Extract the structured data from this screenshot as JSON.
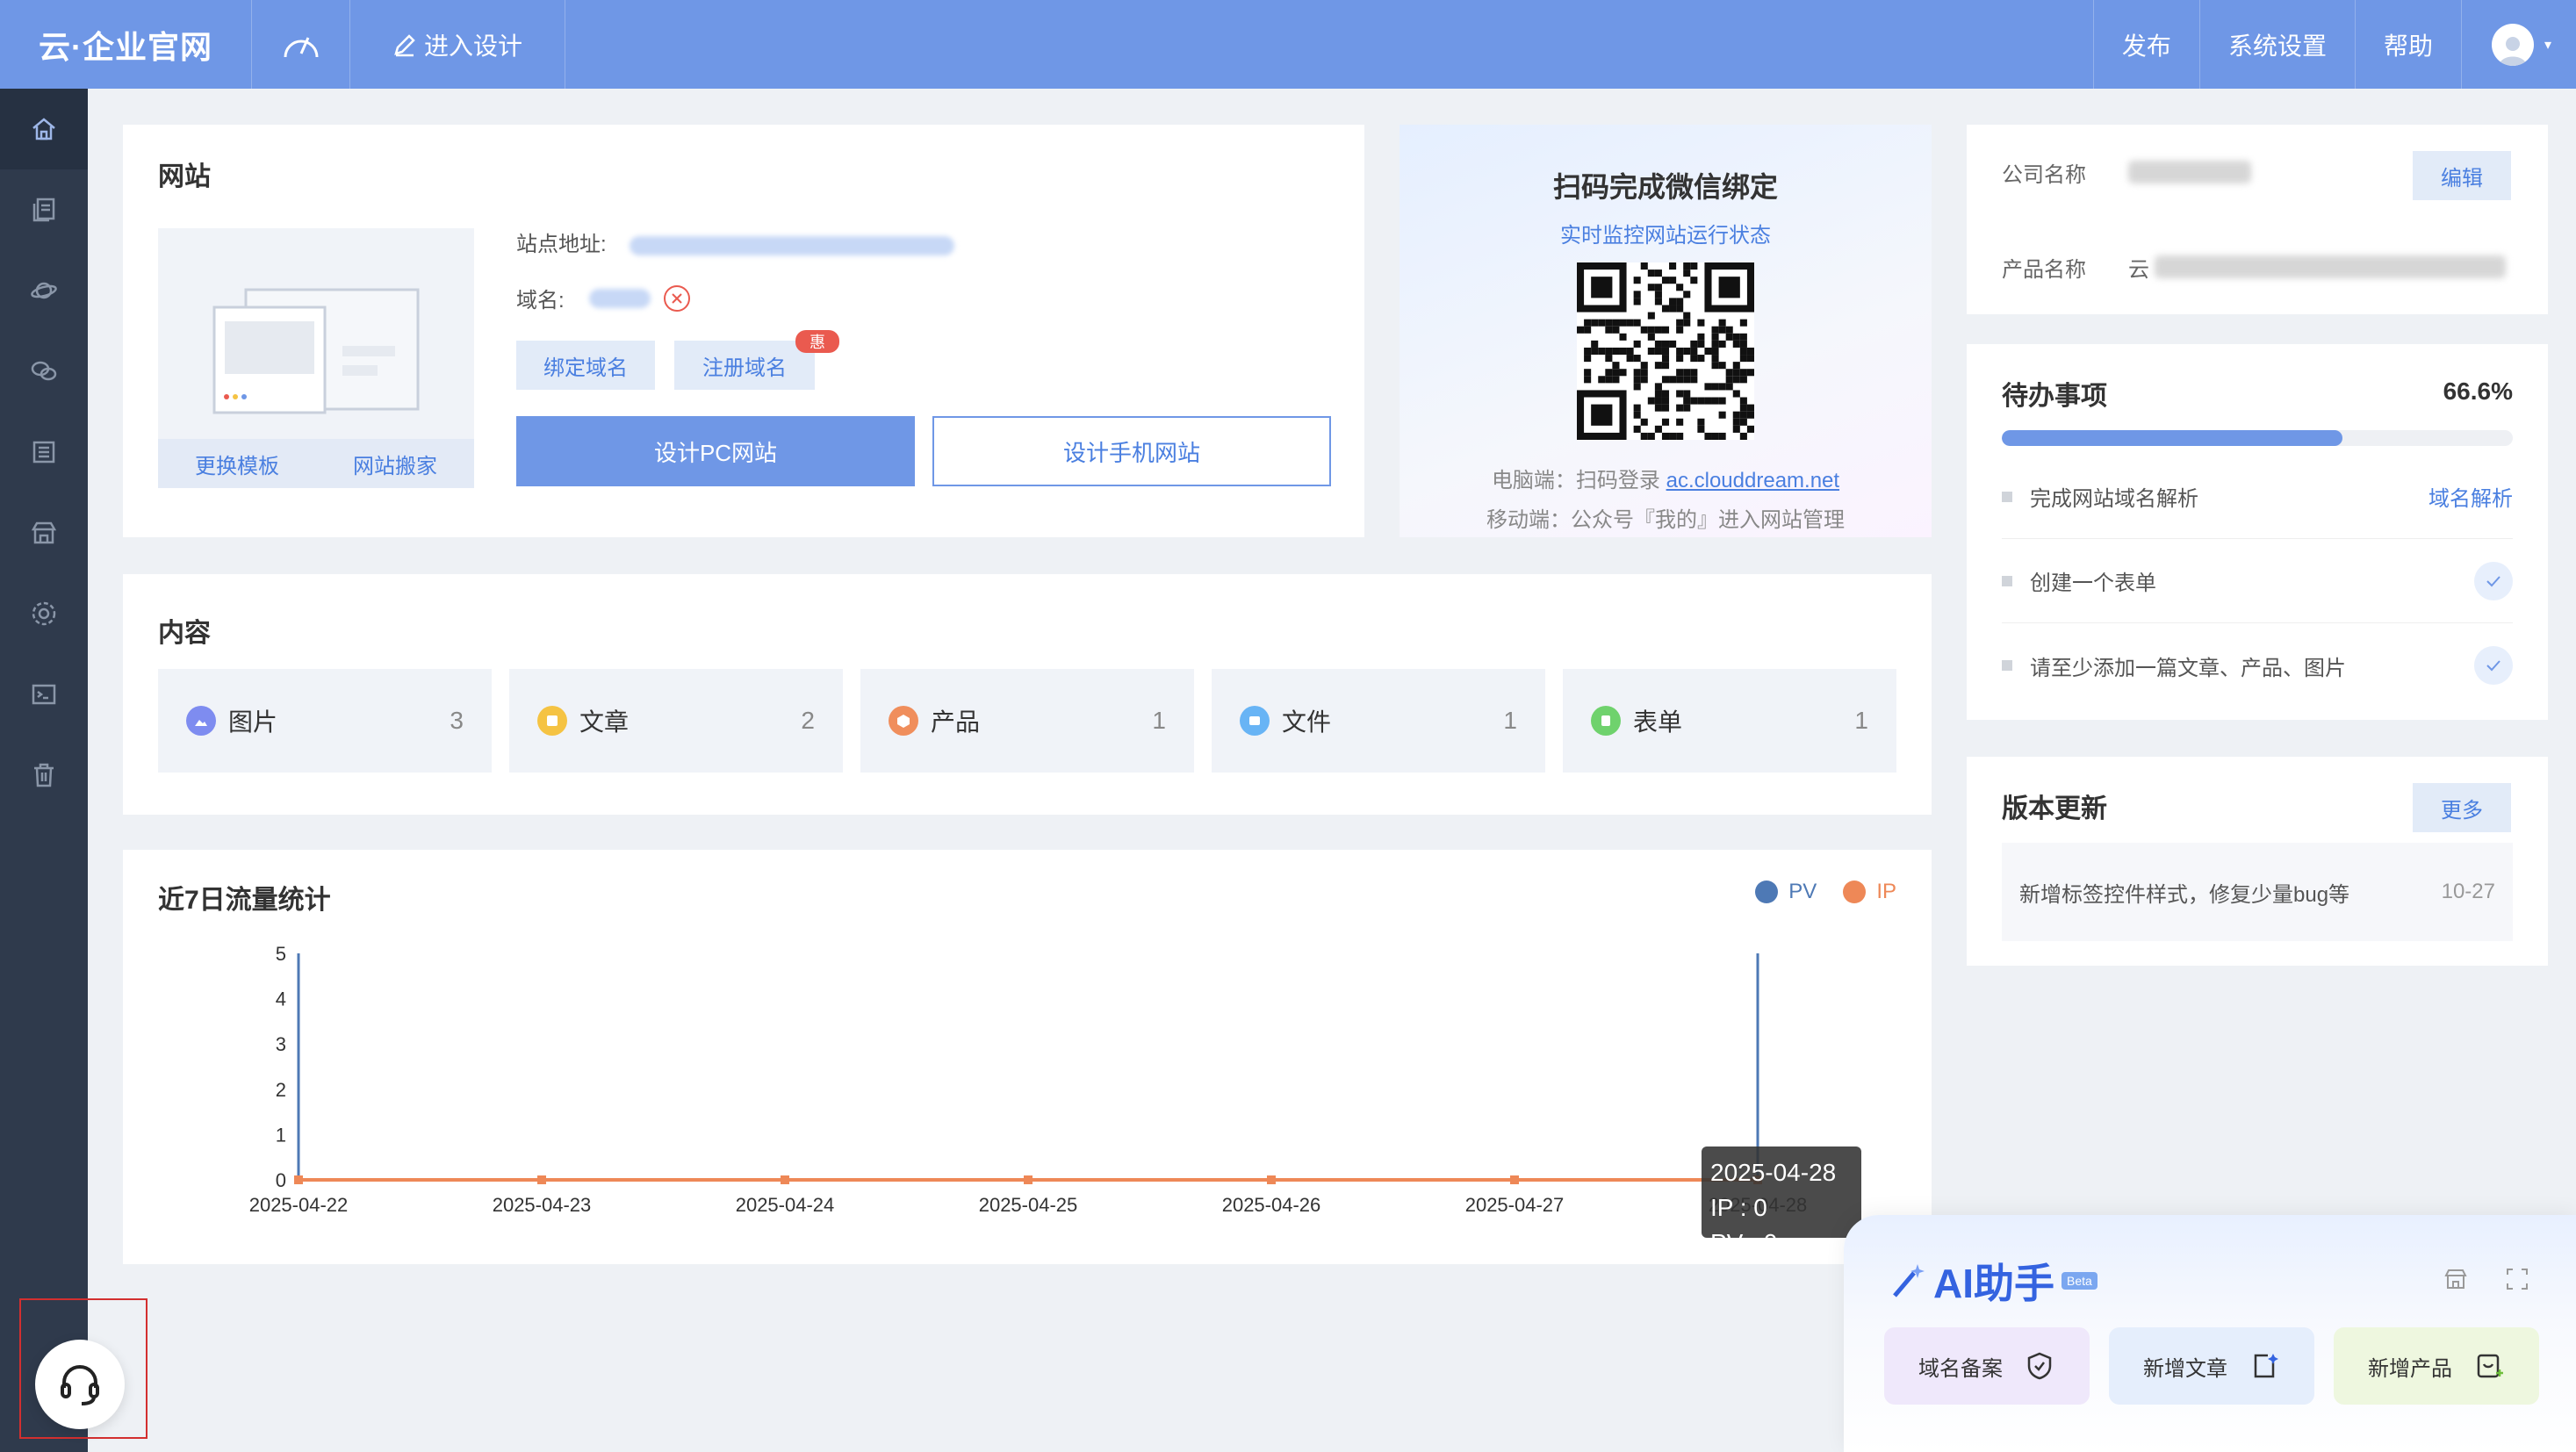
{
  "topbar": {
    "brand": "云·企业官网",
    "design_label": "进入设计",
    "publish": "发布",
    "settings": "系统设置",
    "help": "帮助"
  },
  "website": {
    "title": "网站",
    "site_url_label": "站点地址:",
    "domain_label": "域名:",
    "bind_domain": "绑定域名",
    "register_domain": "注册域名",
    "badge": "惠",
    "change_template": "更换模板",
    "move_site": "网站搬家",
    "design_pc": "设计PC网站",
    "design_mobile": "设计手机网站"
  },
  "qr": {
    "title": "扫码完成微信绑定",
    "subtitle": "实时监控网站运行状态",
    "pc_prefix": "电脑端：扫码登录 ",
    "pc_link": "ac.clouddream.net",
    "mobile_line": "移动端：公众号『我的』进入网站管理"
  },
  "company": {
    "name_label": "公司名称",
    "edit": "编辑",
    "product_label": "产品名称",
    "product_prefix": "云"
  },
  "todo": {
    "title": "待办事项",
    "percent_text": "66.6%",
    "progress": 0.666,
    "items": [
      {
        "text": "完成网站域名解析",
        "action": "域名解析"
      },
      {
        "text": "创建一个表单"
      },
      {
        "text": "请至少添加一篇文章、产品、图片"
      }
    ]
  },
  "content": {
    "title": "内容",
    "tiles": [
      {
        "label": "图片",
        "count": "3",
        "color": "#7e8cf0"
      },
      {
        "label": "文章",
        "count": "2",
        "color": "#f5c343"
      },
      {
        "label": "产品",
        "count": "1",
        "color": "#f08e5c"
      },
      {
        "label": "文件",
        "count": "1",
        "color": "#68b4f5"
      },
      {
        "label": "表单",
        "count": "1",
        "color": "#6fd26d"
      }
    ]
  },
  "version": {
    "title": "版本更新",
    "more": "更多",
    "items": [
      {
        "text": "新增标签控件样式，修复少量bug等",
        "date": "10-27"
      }
    ]
  },
  "chart_data": {
    "type": "line",
    "title": "近7日流量统计",
    "x": [
      "2025-04-22",
      "2025-04-23",
      "2025-04-24",
      "2025-04-25",
      "2025-04-26",
      "2025-04-27",
      "2025-04-28"
    ],
    "series": [
      {
        "name": "PV",
        "values": [
          0,
          0,
          0,
          0,
          0,
          0,
          0
        ],
        "color": "#4e79b5"
      },
      {
        "name": "IP",
        "values": [
          0,
          0,
          0,
          0,
          0,
          0,
          0
        ],
        "color": "#ee8857"
      }
    ],
    "y_ticks": [
      "0",
      "1",
      "2",
      "3",
      "4",
      "5"
    ],
    "ylim": [
      0,
      5
    ],
    "legend": "top-right",
    "tooltip": {
      "date": "2025-04-28",
      "ip_line": "IP : 0",
      "pv_line": "PV : 0"
    }
  },
  "ai": {
    "title": "AI助手",
    "beta": "Beta",
    "buttons": [
      {
        "label": "域名备案",
        "bg": "#efe8fb"
      },
      {
        "label": "新增文章",
        "bg": "#e5eefc"
      },
      {
        "label": "新增产品",
        "bg": "#eef7df"
      }
    ]
  }
}
